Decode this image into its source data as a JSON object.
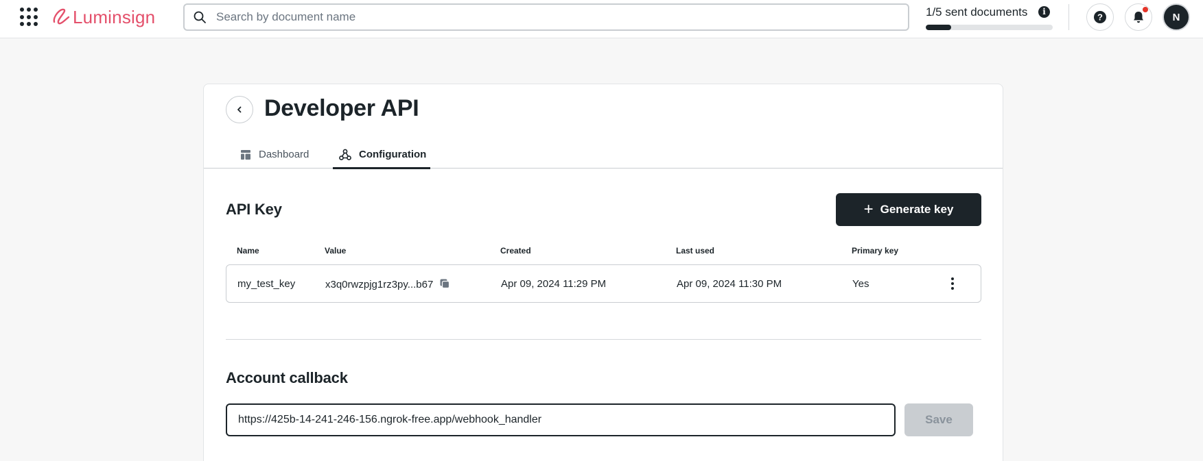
{
  "header": {
    "brand_name": "Luminsign",
    "brand_color": "#e4506b",
    "search_placeholder": "Search by document name",
    "quota_text": "1/5 sent documents",
    "quota_progress": 0.2,
    "avatar_initial": "N",
    "icons": [
      "apps-grid-icon",
      "search-icon",
      "info-icon",
      "help-icon",
      "bell-icon"
    ]
  },
  "page": {
    "title": "Developer API",
    "tabs": [
      {
        "label": "Dashboard",
        "icon": "dashboard-icon",
        "active": false
      },
      {
        "label": "Configuration",
        "icon": "webhook-icon",
        "active": true
      }
    ]
  },
  "api_key": {
    "section_title": "API Key",
    "generate_label": "Generate key",
    "columns": [
      "Name",
      "Value",
      "Created",
      "Last used",
      "Primary key"
    ],
    "rows": [
      {
        "name": "my_test_key",
        "value": "x3q0rwzpjg1rz3py...b67",
        "created": "Apr 09, 2024 11:29 PM",
        "last_used": "Apr 09, 2024 11:30 PM",
        "primary": "Yes"
      }
    ]
  },
  "callback": {
    "section_title": "Account callback",
    "url": "https://425b-14-241-246-156.ngrok-free.app/webhook_handler",
    "save_label": "Save"
  }
}
